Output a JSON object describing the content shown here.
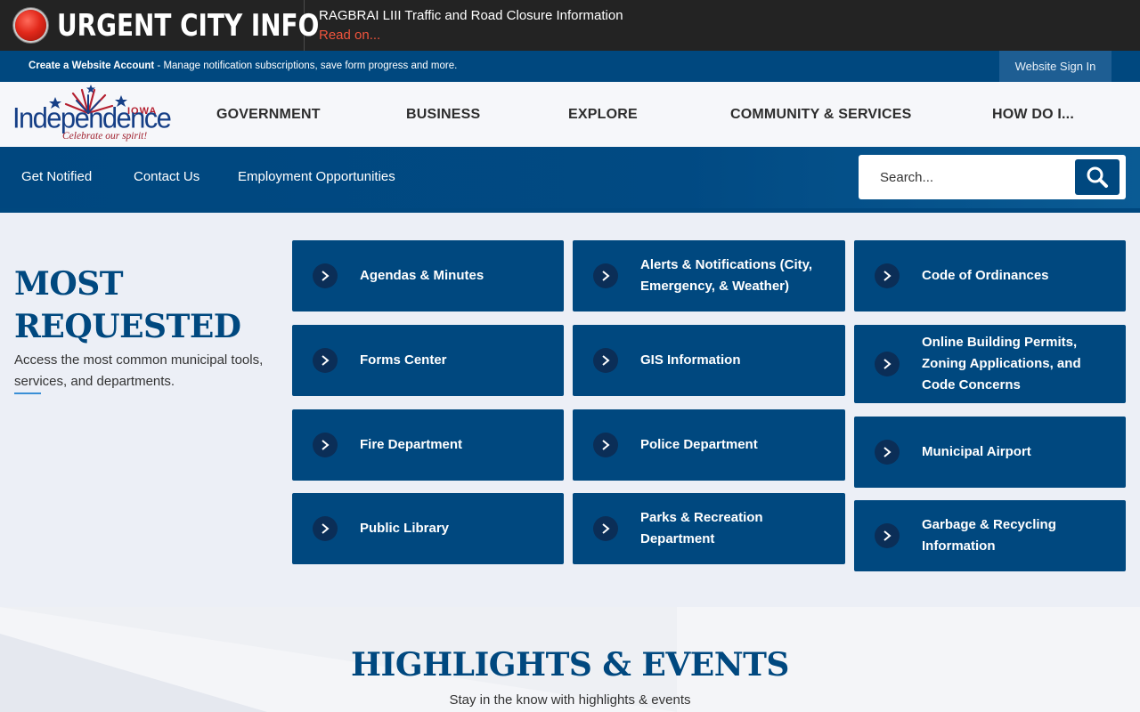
{
  "urgent": {
    "title": "URGENT CITY INFO",
    "message": "RAGBRAI LIII Traffic and Road Closure Information",
    "link": "Read on..."
  },
  "account": {
    "create_label": "Create a Website Account",
    "description": " - Manage notification subscriptions, save form progress and more.",
    "sign_in": "Website Sign In"
  },
  "logo": {
    "state": "IOWA",
    "city": "Independence",
    "tagline": "Celebrate our spirit!"
  },
  "nav": {
    "items": [
      "GOVERNMENT",
      "BUSINESS",
      "EXPLORE",
      "COMMUNITY & SERVICES",
      "HOW DO I..."
    ]
  },
  "subnav": {
    "links": [
      "Get Notified",
      "Contact Us",
      "Employment Opportunities"
    ],
    "search_placeholder": "Search..."
  },
  "most_requested": {
    "title_line1": "MOST",
    "title_line2": "REQUESTED",
    "subtitle": "Access the most common municipal tools, services, and departments.",
    "tiles": [
      [
        "Agendas & Minutes",
        "Alerts & Notifications (City, Emergency, & Weather)",
        "Code of Ordinances"
      ],
      [
        "Forms Center",
        "GIS Information",
        "Online Building Permits, Zoning Applications, and Code Concerns"
      ],
      [
        "Fire Department",
        "Police Department",
        "Municipal Airport"
      ],
      [
        "Public Library",
        "Parks & Recreation Department",
        "Garbage & Recycling Information"
      ]
    ]
  },
  "highlights": {
    "title": "HIGHLIGHTS & EVENTS",
    "subtitle": "Stay in the know with highlights & events"
  },
  "colors": {
    "brand_blue": "#00487f",
    "urgent_bg": "#232323",
    "alert_link": "#f0543c"
  }
}
